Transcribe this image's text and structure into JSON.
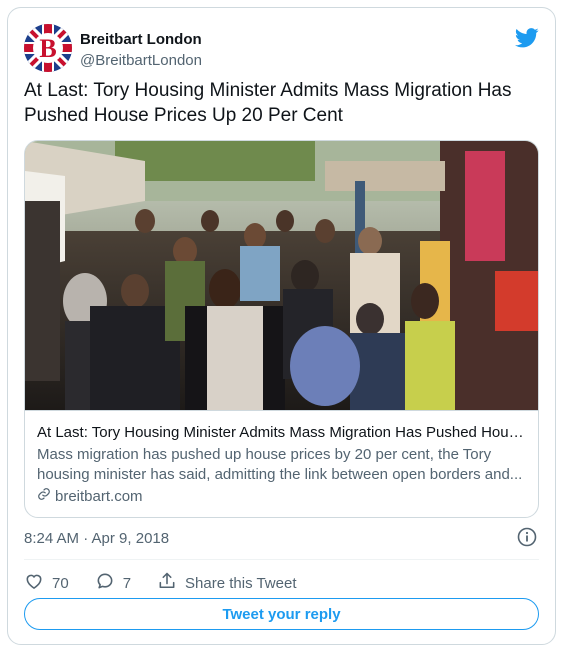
{
  "account": {
    "name": "Breitbart London",
    "handle": "@BreitbartLondon"
  },
  "tweet": {
    "text": "At Last: Tory Housing Minister Admits Mass Migration Has Pushed House Prices Up 20 Per Cent"
  },
  "link_card": {
    "title": "At Last: Tory Housing Minister Admits Mass Migration Has Pushed Hous...",
    "description": "Mass migration has pushed up house prices by 20 per cent, the Tory housing minister has said, admitting the link between open borders and...",
    "domain": "breitbart.com"
  },
  "meta": {
    "timestamp": "8:24 AM · Apr 9, 2018"
  },
  "actions": {
    "likes": "70",
    "replies": "7",
    "share_label": "Share this Tweet"
  },
  "reply_button": {
    "label": "Tweet your reply"
  },
  "colors": {
    "accent": "#1d9bf0",
    "text": "#0f1419",
    "secondary": "#536471",
    "border": "#cfd9de"
  },
  "icons": [
    "twitter-bird-icon",
    "info-icon",
    "heart-icon",
    "reply-icon",
    "share-icon",
    "link-icon"
  ]
}
